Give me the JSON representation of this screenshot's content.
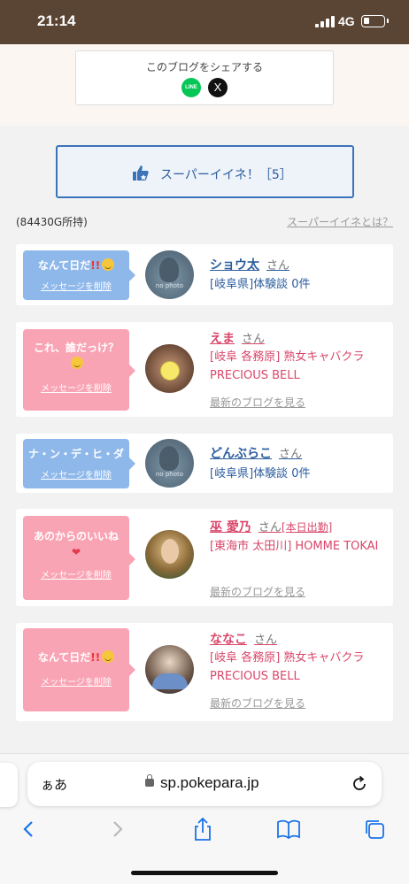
{
  "status_bar": {
    "time": "21:14",
    "network": "4G",
    "battery_level": 0.3
  },
  "share": {
    "title": "このブログをシェアする",
    "line_label": "LINE",
    "x_label": "X"
  },
  "super_like": {
    "label": "スーパーイイネ！［5］",
    "owned": "(84430G所持)",
    "what_link": "スーパーイイネとは？"
  },
  "cards": [
    {
      "message": "なんて日だ",
      "delete_label": "メッセージを削除",
      "name": "ショウ太",
      "san": "さん",
      "info": "[岐阜県]体験談 0件",
      "nophoto": "no photo"
    },
    {
      "message": "これ、誰だっけ？",
      "delete_label": "メッセージを削除",
      "name": "えま",
      "san": "さん",
      "info": "[岐阜 各務原] 熟女キャバクラ PRECIOUS BELL",
      "blog_link": "最新のブログを見る"
    },
    {
      "message": "ナ・ン・デ・ヒ・ダ",
      "delete_label": "メッセージを削除",
      "name": "どんぶらこ",
      "san": "さん",
      "info": "[岐阜県]体験談 0件",
      "nophoto": "no photo"
    },
    {
      "message": "あのからのいいね",
      "delete_label": "メッセージを削除",
      "name": "巫 愛乃",
      "san": "さん",
      "status": "[本日出勤]",
      "info": "[東海市 太田川] HOMME TOKAI",
      "blog_link": "最新のブログを見る"
    },
    {
      "message": "なんて日だ",
      "delete_label": "メッセージを削除",
      "name": "ななこ",
      "san": "さん",
      "info": "[岐阜 各務原] 熟女キャバクラ PRECIOUS BELL",
      "blog_link": "最新のブログを見る"
    }
  ],
  "browser": {
    "aa": "ぁあ",
    "url": "sp.pokepara.jp"
  },
  "colors": {
    "status_bar": "#5a4535",
    "link_blue": "#2b5d9e",
    "pink": "#d9466a",
    "bubble_blue": "#8fb8ea",
    "bubble_pink": "#f9a4b4"
  }
}
